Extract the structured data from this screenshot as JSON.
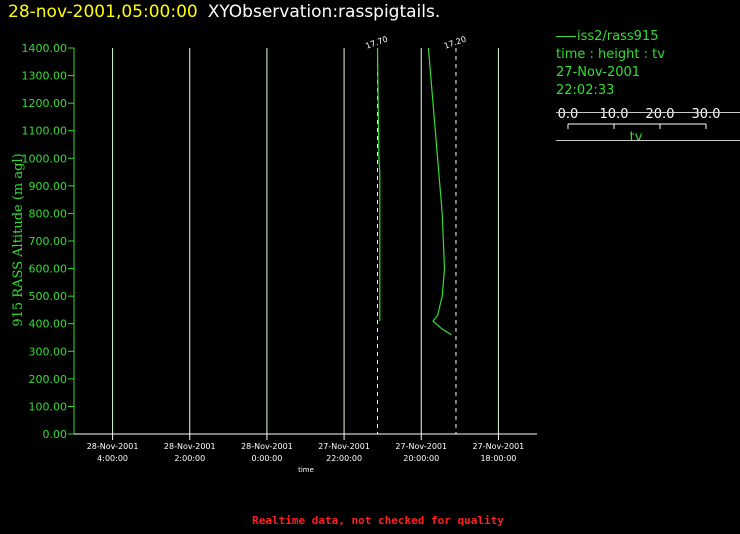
{
  "title": {
    "date": "28-nov-2001,05:00:00",
    "observation": "XYObservation:rasspigtails."
  },
  "legend": {
    "series_label": "iss2/rass915",
    "variables": "time : height : tv",
    "date": "27-Nov-2001",
    "time": "22:02:33",
    "scale_ticks": [
      "0.0",
      "10.0",
      "20.0",
      "30.0"
    ],
    "scale_label": "tv"
  },
  "footer_note": "Realtime data, not checked for quality",
  "colors": {
    "series": "#33dd33",
    "axis": "#33dd33",
    "grid": "#ddffdd",
    "title_date": "#ffff00",
    "title_obs": "#ffffff",
    "note": "#ff2020"
  },
  "chart_data": {
    "type": "line",
    "title": "28-nov-2001,05:00:00 XYObservation:rasspigtails.",
    "xlabel": "time",
    "ylabel": "915 RASS Altitude (m agl)",
    "ylim": [
      0,
      1400
    ],
    "yticks": [
      "0.00",
      "100.00",
      "200.00",
      "300.00",
      "400.00",
      "500.00",
      "600.00",
      "700.00",
      "800.00",
      "900.00",
      "1000.00",
      "1100.00",
      "1200.00",
      "1300.00",
      "1400.00"
    ],
    "x_reversed": true,
    "xlim": [
      "2001-11-28 05:00",
      "2001-11-27 17:00"
    ],
    "xticks": [
      {
        "date": "28-Nov-2001",
        "time": "4:00:00",
        "at": "2001-11-28 04:00"
      },
      {
        "date": "28-Nov-2001",
        "time": "2:00:00",
        "at": "2001-11-28 02:00"
      },
      {
        "date": "28-Nov-2001",
        "time": "0:00:00",
        "at": "2001-11-28 00:00"
      },
      {
        "date": "27-Nov-2001",
        "time": "22:00:00",
        "at": "2001-11-27 22:00"
      },
      {
        "date": "27-Nov-2001",
        "time": "20:00:00",
        "at": "2001-11-27 20:00"
      },
      {
        "date": "27-Nov-2001",
        "time": "18:00:00",
        "at": "2001-11-27 18:00"
      }
    ],
    "grid": true,
    "series": [
      {
        "label": "17.70",
        "base_time": "2001-11-27 21:08",
        "x_scale_ticks": [
          0,
          10,
          20,
          30
        ],
        "points": [
          {
            "tv": 0.5,
            "height": 410
          },
          {
            "tv": 0.5,
            "height": 950
          },
          {
            "tv": 0.3,
            "height": 1000
          },
          {
            "tv": 0.0,
            "height": 1400
          }
        ]
      },
      {
        "label": "17.20",
        "base_time": "2001-11-27 19:06",
        "points": [
          {
            "tv": -6.0,
            "height": 1400
          },
          {
            "tv": -5.0,
            "height": 1200
          },
          {
            "tv": -4.0,
            "height": 1000
          },
          {
            "tv": -3.0,
            "height": 800
          },
          {
            "tv": -2.5,
            "height": 600
          },
          {
            "tv": -3.0,
            "height": 500
          },
          {
            "tv": -4.0,
            "height": 430
          },
          {
            "tv": -5.0,
            "height": 410
          },
          {
            "tv": -3.0,
            "height": 380
          },
          {
            "tv": -1.0,
            "height": 360
          }
        ]
      }
    ]
  }
}
